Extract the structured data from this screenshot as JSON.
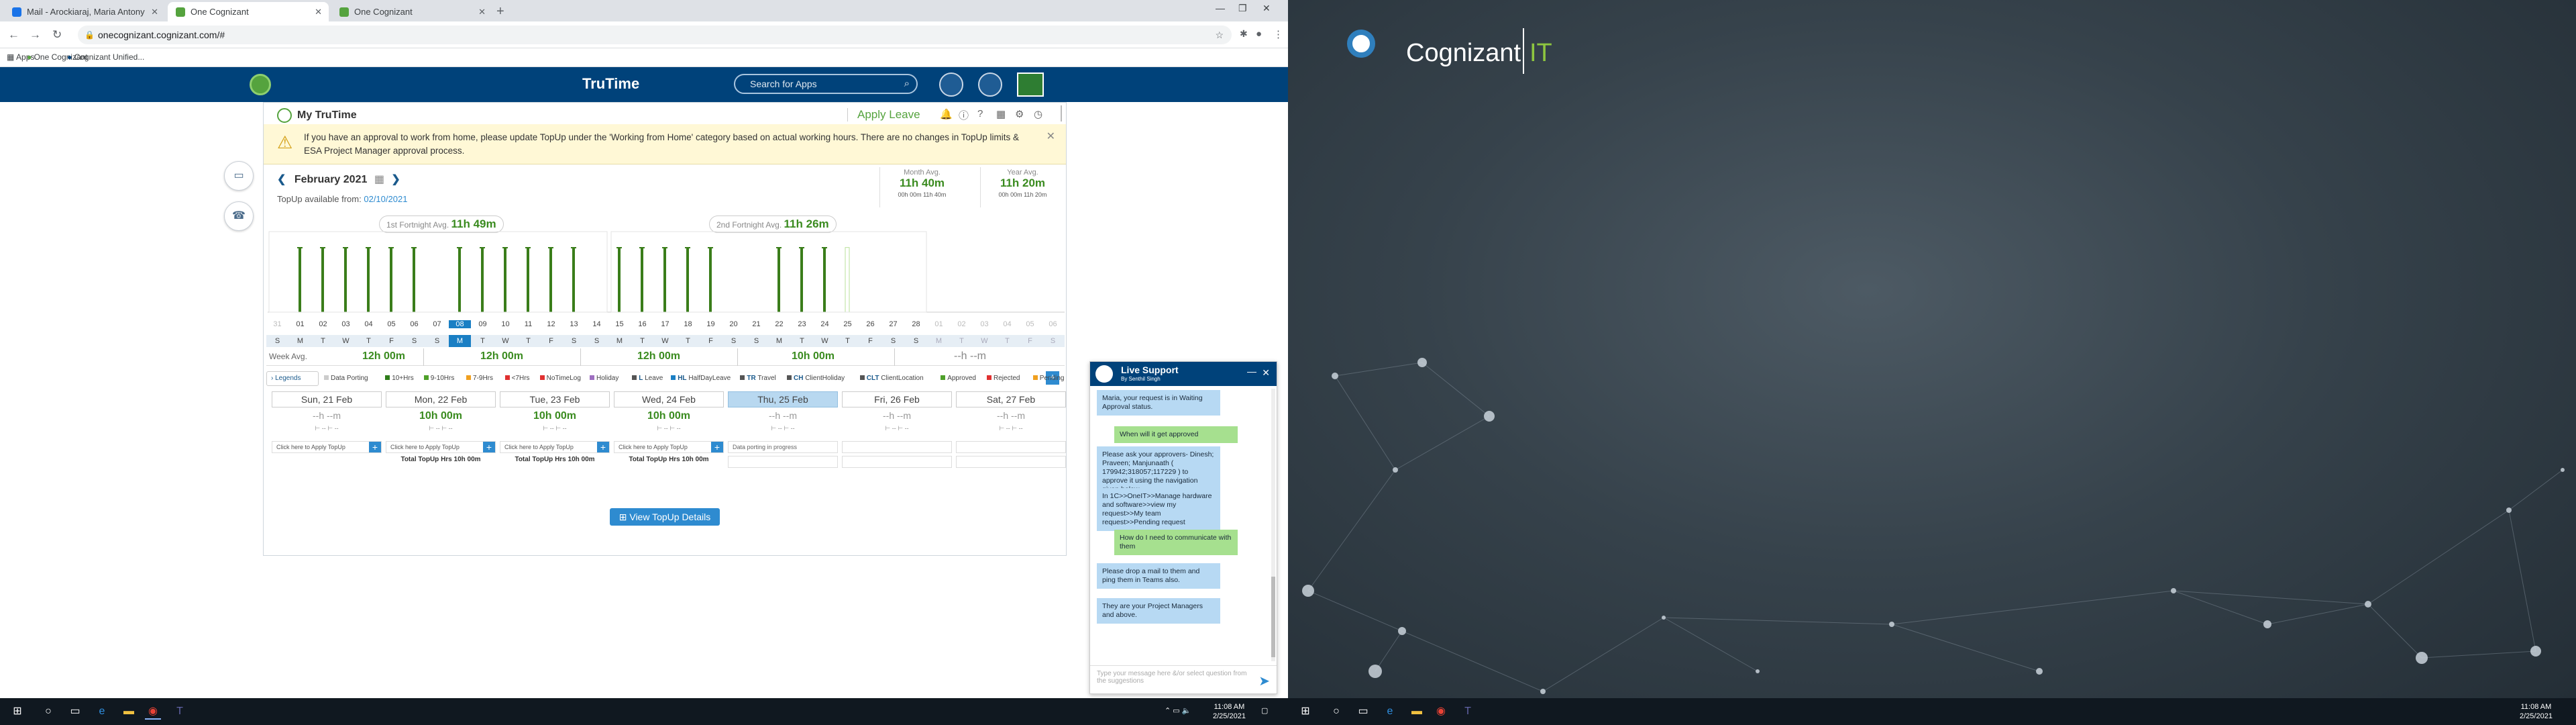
{
  "browser": {
    "tabs": [
      {
        "label": "Mail - Arockiaraj, Maria Antony",
        "active": false
      },
      {
        "label": "One Cognizant",
        "active": true
      },
      {
        "label": "One Cognizant",
        "active": false
      }
    ],
    "url": "onecognizant.cognizant.com/#",
    "bookmarks": [
      "Apps",
      "One Cognizant",
      "Cognizant Unified..."
    ]
  },
  "header": {
    "title": "TruTime",
    "search_placeholder": "Search for Apps"
  },
  "panel": {
    "my_trutime": "My TruTime",
    "apply_leave": "Apply Leave",
    "alert": "If you have an approval to work from home, please update TopUp under the 'Working from Home' category based on actual working hours. There are no changes in TopUp limits & ESA Project Manager approval process.",
    "month": "February 2021",
    "topup_label": "TopUp available from:",
    "topup_date": "02/10/2021",
    "month_avg_label": "Month Avg.",
    "month_avg": "11h 40m",
    "month_avg_sub": "00h 00m   11h 40m",
    "year_avg_label": "Year Avg.",
    "year_avg": "11h 20m",
    "year_avg_sub": "00h 00m   11h 20m",
    "fortnight1_label": "1st Fortnight Avg.",
    "fortnight1": "11h 49m",
    "fortnight2_label": "2nd Fortnight Avg.",
    "fortnight2": "11h 26m",
    "week_avg_label": "Week Avg.",
    "week_avgs": [
      "12h 00m",
      "12h 00m",
      "12h 00m",
      "10h 00m",
      "--h --m"
    ],
    "legend_btn": "Legends",
    "legend_items": [
      "Data Porting",
      "10+Hrs",
      "9-10Hrs",
      "7-9Hrs",
      "<7Hrs",
      "NoTimeLog",
      "Holiday",
      "Leave",
      "HalfDayLeave",
      "Travel",
      "ClientHoliday",
      "ClientLocation",
      "Approved",
      "Rejected",
      "Pending"
    ],
    "legend_codes": [
      "",
      "",
      "",
      "",
      "",
      "",
      "",
      "L",
      "HL",
      "TR",
      "CH",
      "CLT",
      "",
      "",
      ""
    ],
    "legend_colors": [
      "#cccccc",
      "#2e7d1a",
      "#4fa02a",
      "#f0a020",
      "#e03030",
      "#e03030",
      "#9e6fc0",
      "#555555",
      "#1a7fc4",
      "#555555",
      "#555555",
      "#555555",
      "#4fa02a",
      "#e03030",
      "#f0a020"
    ],
    "view_topup": "View TopUp Details"
  },
  "days": {
    "numbers": [
      "31",
      "01",
      "02",
      "03",
      "04",
      "05",
      "06",
      "07",
      "08",
      "09",
      "10",
      "11",
      "12",
      "13",
      "14",
      "15",
      "16",
      "17",
      "18",
      "19",
      "20",
      "21",
      "22",
      "23",
      "24",
      "25",
      "26",
      "27",
      "28",
      "01",
      "02",
      "03",
      "04",
      "05",
      "06"
    ],
    "weekdays": [
      "S",
      "M",
      "T",
      "W",
      "T",
      "F",
      "S",
      "S",
      "M",
      "T",
      "W",
      "T",
      "F",
      "S",
      "S",
      "M",
      "T",
      "W",
      "T",
      "F",
      "S",
      "S",
      "M",
      "T",
      "W",
      "T",
      "F",
      "S",
      "S",
      "M",
      "T",
      "W",
      "T",
      "F",
      "S"
    ],
    "selected_index": 8
  },
  "chart_data": {
    "type": "bar",
    "categories": [
      "31",
      "01",
      "02",
      "03",
      "04",
      "05",
      "06",
      "07",
      "08",
      "09",
      "10",
      "11",
      "12",
      "13",
      "14",
      "15",
      "16",
      "17",
      "18",
      "19",
      "20",
      "21",
      "22",
      "23",
      "24",
      "25",
      "26",
      "27",
      "28",
      "01",
      "02",
      "03",
      "04",
      "05",
      "06"
    ],
    "values": [
      0,
      12,
      12,
      12,
      12,
      12,
      12,
      0,
      12,
      12,
      12,
      12,
      12,
      12,
      0,
      12,
      12,
      12,
      12,
      12,
      0,
      0,
      12,
      12,
      12,
      0,
      0,
      0,
      0,
      0,
      0,
      0,
      0,
      0,
      0
    ],
    "ylim": [
      0,
      14
    ]
  },
  "cards": [
    {
      "day": "Sun, 21 Feb",
      "hours": "--h --m",
      "apply": "Click here to Apply TopUp",
      "total": "",
      "today": false
    },
    {
      "day": "Mon, 22 Feb",
      "hours": "10h 00m",
      "apply": "Click here to Apply TopUp",
      "total": "Total TopUp Hrs 10h 00m",
      "today": false
    },
    {
      "day": "Tue, 23 Feb",
      "hours": "10h 00m",
      "apply": "Click here to Apply TopUp",
      "total": "Total TopUp Hrs 10h 00m",
      "today": false
    },
    {
      "day": "Wed, 24 Feb",
      "hours": "10h 00m",
      "apply": "Click here to Apply TopUp",
      "total": "Total TopUp Hrs 10h 00m",
      "today": false
    },
    {
      "day": "Thu, 25 Feb",
      "hours": "--h --m",
      "apply": "Data porting in progress",
      "total": "",
      "today": true
    },
    {
      "day": "Fri, 26 Feb",
      "hours": "--h --m",
      "apply": "",
      "total": "",
      "today": false
    },
    {
      "day": "Sat, 27 Feb",
      "hours": "--h --m",
      "apply": "",
      "total": "",
      "today": false
    }
  ],
  "chat": {
    "title": "Live Support",
    "subtitle": "By Senthil Singh",
    "messages": [
      {
        "from": "agent",
        "text": "Maria, your request is in Waiting Approval status."
      },
      {
        "from": "user",
        "text": "When will it get approved"
      },
      {
        "from": "agent",
        "text": "Please ask your approvers- Dinesh; Praveen; Manjunaath ( 179942;318057;117229 ) to approve it using the navigation given below."
      },
      {
        "from": "agent",
        "text": "In 1C>>OneIT>>Manage hardware and software>>view my request>>My team request>>Pending request"
      },
      {
        "from": "user",
        "text": "How do I need to communicate with them"
      },
      {
        "from": "agent",
        "text": "Please drop a mail to them and ping them in Teams also."
      },
      {
        "from": "agent",
        "text": "They are your Project Managers and above."
      }
    ],
    "input_placeholder": "Type your message here &/or select question from the suggestions"
  },
  "taskbar": {
    "time": "11:08 AM",
    "date": "2/25/2021"
  },
  "desktop": {
    "brand": "Cognizant",
    "brand_suffix": "IT"
  }
}
